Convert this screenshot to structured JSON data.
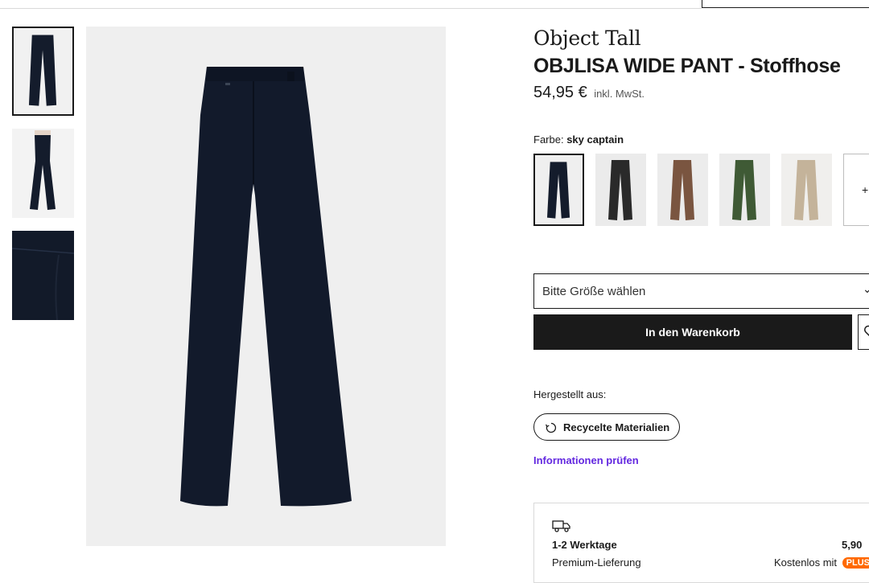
{
  "product": {
    "brand": "Object Tall",
    "name": "OBJLISA WIDE PANT - Stoffhose",
    "price": "54,95 €",
    "vat_note": "inkl. MwSt."
  },
  "gallery": {
    "thumbnails": [
      "pants-front-thumbnail",
      "pants-model-thumbnail",
      "fabric-detail-thumbnail"
    ],
    "selected_index": 0
  },
  "color": {
    "label": "Farbe:",
    "selected": "sky captain",
    "swatch_colors": [
      "#141c2c",
      "#2a2a2a",
      "#7a5540",
      "#3f5a35",
      "#c4b39a"
    ],
    "more_symbol": "+"
  },
  "size": {
    "placeholder": "Bitte Größe wählen",
    "chevron_icon": "chevron-down-icon"
  },
  "actions": {
    "add_to_cart": "In den Warenkorb",
    "wishlist_icon": "heart-icon"
  },
  "material": {
    "label": "Hergestellt aus:",
    "badge": "Recycelte Materialien",
    "badge_icon": "recycle-icon",
    "info_link": "Informationen prüfen",
    "link_color": "#6328e0"
  },
  "delivery": {
    "icon": "truck-icon",
    "days": "1-2 Werktage",
    "price": "5,90",
    "type": "Premium-Lieferung",
    "free_text": "Kostenlos mit",
    "plus_badge": "PLUS",
    "plus_color": "#ff6900"
  }
}
